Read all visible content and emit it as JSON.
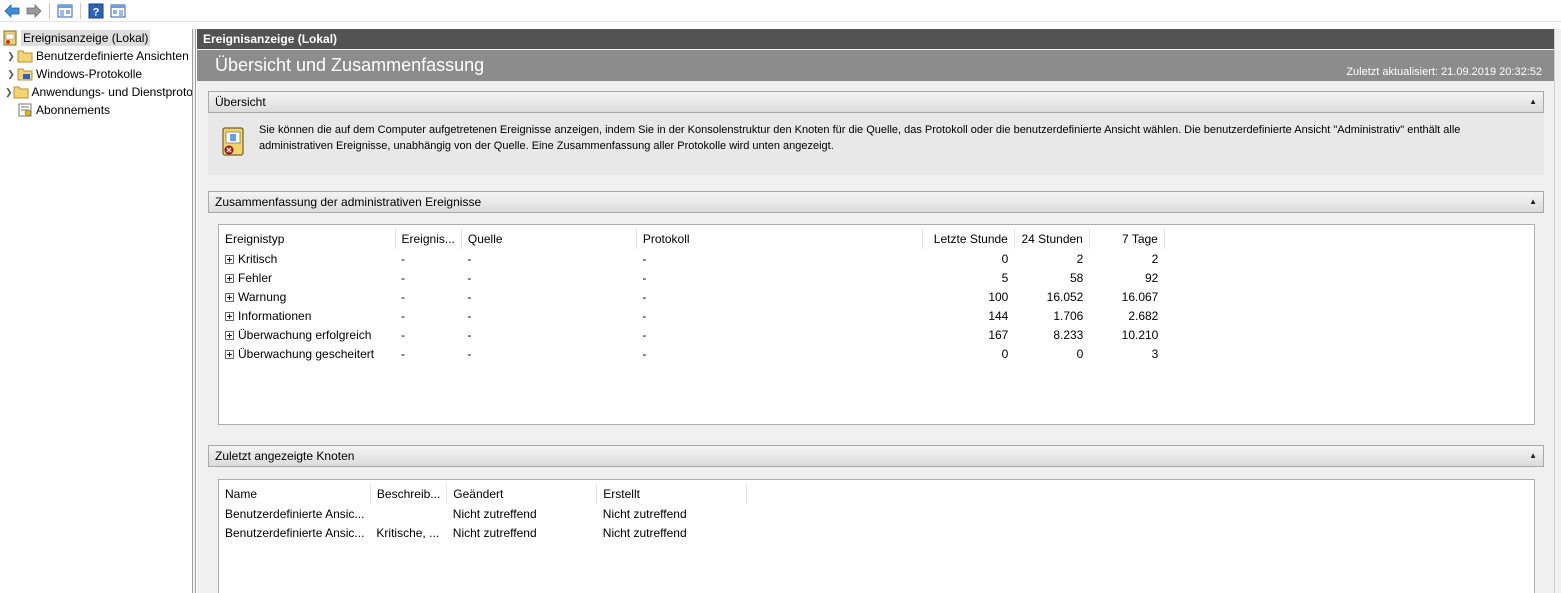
{
  "toolbar": {
    "icons": [
      "back-icon",
      "forward-icon",
      "show-hide-console-tree-icon",
      "help-icon",
      "show-hide-action-pane-icon"
    ]
  },
  "tree": {
    "root": "Ereignisanzeige (Lokal)",
    "items": [
      {
        "label": "Benutzerdefinierte Ansichten",
        "expandable": true
      },
      {
        "label": "Windows-Protokolle",
        "expandable": true
      },
      {
        "label": "Anwendungs- und Dienstprotokolle",
        "expandable": true
      },
      {
        "label": "Abonnements",
        "expandable": false
      }
    ]
  },
  "main": {
    "header": "Ereignisanzeige (Lokal)",
    "title": "Übersicht und Zusammenfassung",
    "updated": "Zuletzt aktualisiert: 21.09.2019 20:32:52",
    "overview": {
      "heading": "Übersicht",
      "text": "Sie können die auf dem Computer aufgetretenen Ereignisse anzeigen, indem Sie in der Konsolenstruktur den Knoten für die Quelle, das Protokoll oder die benutzerdefinierte Ansicht wählen. Die benutzerdefinierte Ansicht \"Administrativ\" enthält alle administrativen Ereignisse, unabhängig von der Quelle. Eine Zusammenfassung aller Protokolle wird unten angezeigt."
    },
    "summary": {
      "heading": "Zusammenfassung der administrativen Ereignisse",
      "columns": [
        "Ereignistyp",
        "Ereignis...",
        "Quelle",
        "Protokoll",
        "Letzte Stunde",
        "24 Stunden",
        "7 Tage"
      ],
      "rows": [
        {
          "type": "Kritisch",
          "id": "-",
          "source": "-",
          "log": "-",
          "hour": "0",
          "day": "2",
          "week": "2"
        },
        {
          "type": "Fehler",
          "id": "-",
          "source": "-",
          "log": "-",
          "hour": "5",
          "day": "58",
          "week": "92"
        },
        {
          "type": "Warnung",
          "id": "-",
          "source": "-",
          "log": "-",
          "hour": "100",
          "day": "16.052",
          "week": "16.067"
        },
        {
          "type": "Informationen",
          "id": "-",
          "source": "-",
          "log": "-",
          "hour": "144",
          "day": "1.706",
          "week": "2.682"
        },
        {
          "type": "Überwachung erfolgreich",
          "id": "-",
          "source": "-",
          "log": "-",
          "hour": "167",
          "day": "8.233",
          "week": "10.210"
        },
        {
          "type": "Überwachung gescheitert",
          "id": "-",
          "source": "-",
          "log": "-",
          "hour": "0",
          "day": "0",
          "week": "3"
        }
      ]
    },
    "recent": {
      "heading": "Zuletzt angezeigte Knoten",
      "columns": [
        "Name",
        "Beschreib...",
        "Geändert",
        "Erstellt"
      ],
      "rows": [
        {
          "name": "Benutzerdefinierte Ansic...",
          "desc": "",
          "changed": "Nicht zutreffend",
          "created": "Nicht zutreffend"
        },
        {
          "name": "Benutzerdefinierte Ansic...",
          "desc": "Kritische, ...",
          "changed": "Nicht zutreffend",
          "created": "Nicht zutreffend"
        }
      ]
    }
  }
}
